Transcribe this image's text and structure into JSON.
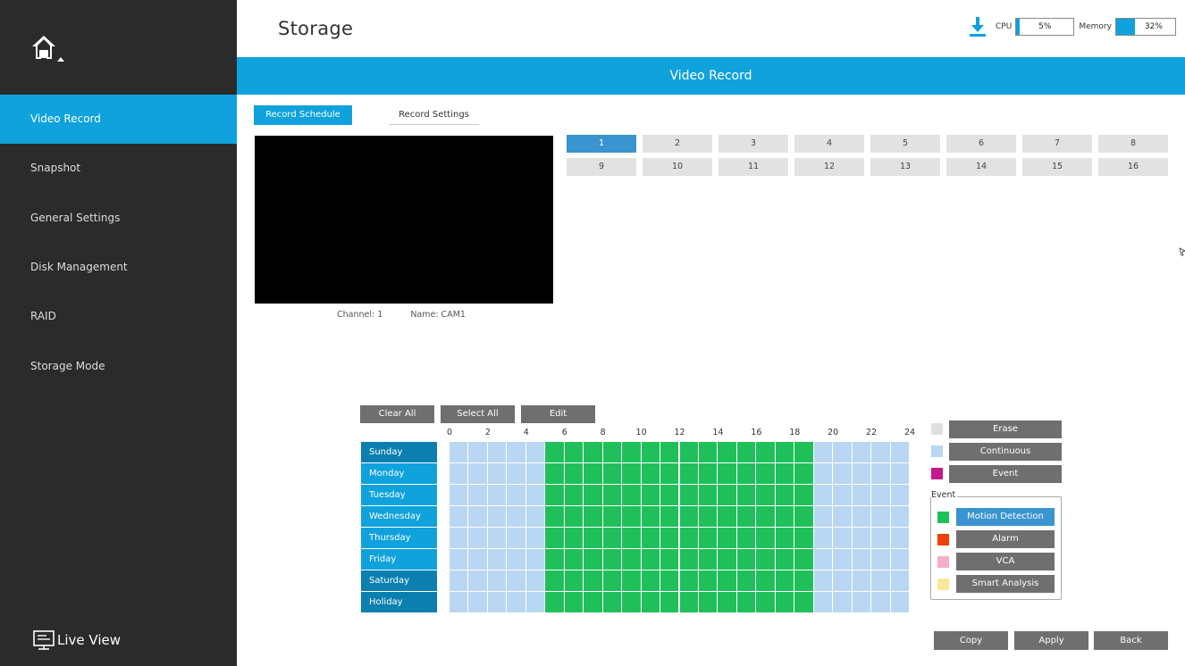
{
  "sidebar": {
    "items": [
      {
        "label": "Video Record",
        "active": true
      },
      {
        "label": "Snapshot",
        "active": false
      },
      {
        "label": "General Settings",
        "active": false
      },
      {
        "label": "Disk Management",
        "active": false
      },
      {
        "label": "RAID",
        "active": false
      },
      {
        "label": "Storage Mode",
        "active": false
      }
    ],
    "live_view": "Live View"
  },
  "header": {
    "title": "Storage",
    "cpu_label": "CPU",
    "cpu_value": "5%",
    "cpu_fraction": 0.05,
    "memory_label": "Memory",
    "memory_value": "32%",
    "memory_fraction": 0.32
  },
  "banner": {
    "title": "Video Record"
  },
  "tabs": [
    {
      "label": "Record Schedule",
      "active": true
    },
    {
      "label": "Record Settings",
      "active": false
    }
  ],
  "preview": {
    "channel": "Channel: 1",
    "name": "Name: CAM1"
  },
  "channels": {
    "items": [
      "1",
      "2",
      "3",
      "4",
      "5",
      "6",
      "7",
      "8",
      "9",
      "10",
      "11",
      "12",
      "13",
      "14",
      "15",
      "16"
    ],
    "selected": "1"
  },
  "schedule_toolbar": {
    "clear_all": "Clear All",
    "select_all": "Select All",
    "edit": "Edit"
  },
  "schedule": {
    "hour_labels": [
      "0",
      "2",
      "4",
      "6",
      "8",
      "10",
      "12",
      "14",
      "16",
      "18",
      "20",
      "22",
      "24"
    ],
    "days": [
      "Sunday",
      "Monday",
      "Tuesday",
      "Wednesday",
      "Thursday",
      "Friday",
      "Saturday",
      "Holiday"
    ],
    "motion_start_hour": 5,
    "motion_end_hour": 19,
    "base_mode": "Continuous",
    "span_mode": "Motion Detection"
  },
  "legend": {
    "erase": "Erase",
    "continuous": "Continuous",
    "event": "Event",
    "event_group_label": "Event",
    "motion_detection": "Motion Detection",
    "alarm": "Alarm",
    "vca": "VCA",
    "smart_analysis": "Smart Analysis",
    "colors": {
      "erase": "#e0e0e0",
      "continuous": "#b9d7f2",
      "event": "#c6198c",
      "motion_detection": "#1fc05a",
      "alarm": "#f0400a",
      "vca": "#f5afc8",
      "smart_analysis": "#fbe79a"
    }
  },
  "actions": {
    "copy": "Copy",
    "apply": "Apply",
    "back": "Back"
  }
}
